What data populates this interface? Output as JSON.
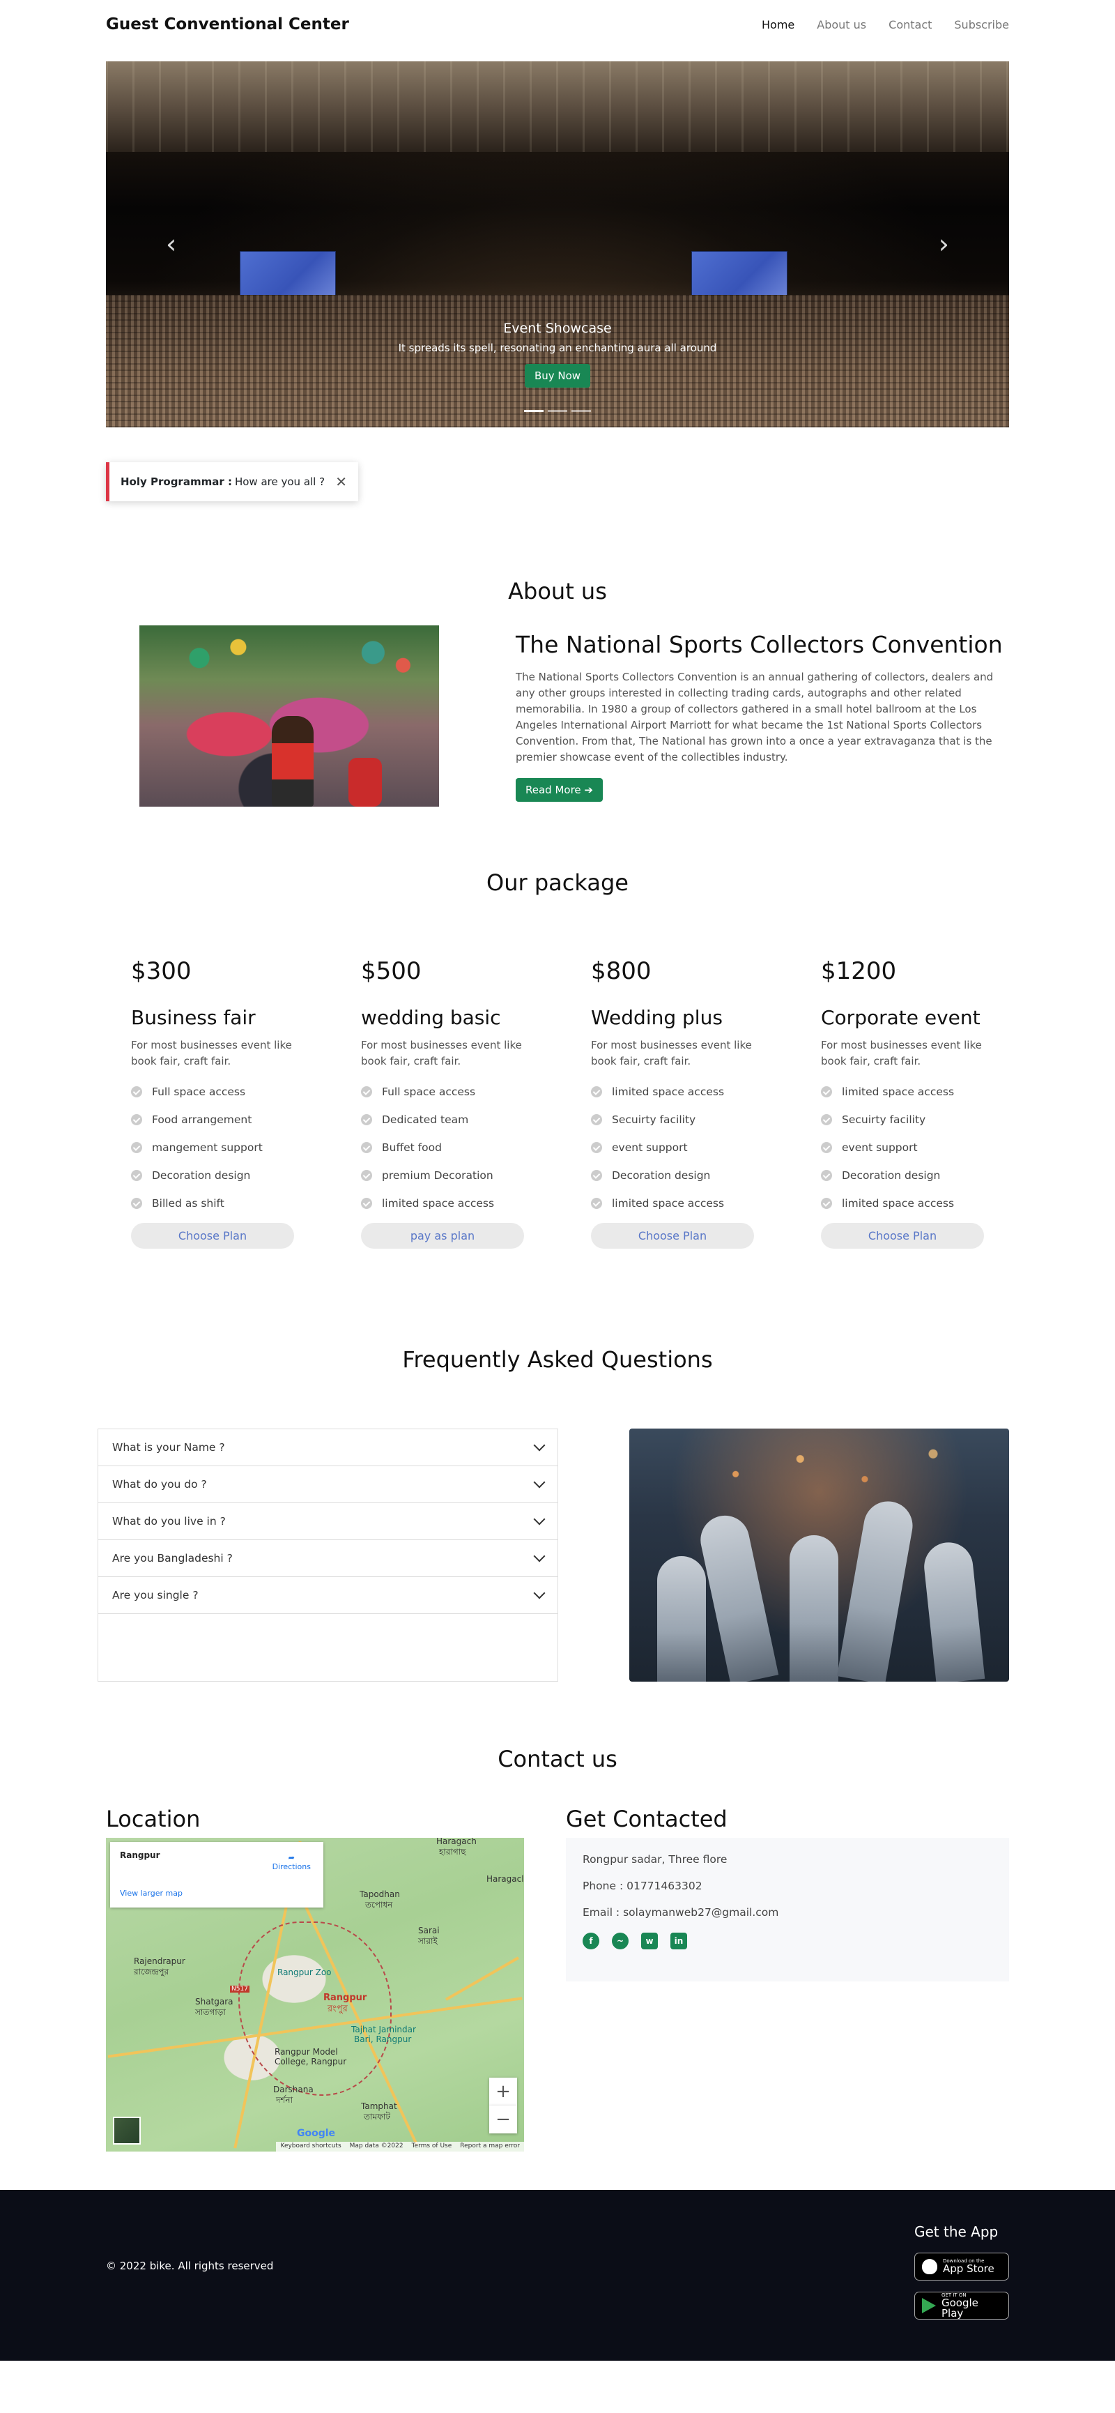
{
  "nav": {
    "brand": "Guest Conventional Center",
    "links": [
      "Home",
      "About us",
      "Contact",
      "Subscribe"
    ]
  },
  "hero": {
    "title": "Event Showcase",
    "subtitle": "It spreads its spell, resonating an enchanting aura all around",
    "button": "Buy Now",
    "prev_icon": "‹",
    "next_icon": "›"
  },
  "toast": {
    "sender": "Holy Programmar :",
    "message": "How are you all ?",
    "close": "✕"
  },
  "about": {
    "section_title": "About us",
    "heading": "The National Sports Collectors Convention",
    "body": "The National Sports Collectors Convention is an annual gathering of collectors, dealers and any other groups interested in collecting trading cards, autographs and other related memorabilia. In 1980 a group of collectors gathered in a small hotel ballroom at the Los Angeles International Airport Marriott for what became the 1st National Sports Collectors Convention. From that, The National has grown into a once a year extravaganza that is the premier showcase event of the collectibles industry.",
    "button": "Read More ➔"
  },
  "packages": {
    "section_title": "Our package",
    "items": [
      {
        "price": "$300",
        "name": "Business fair",
        "desc": "For most businesses event like book fair, craft fair.",
        "features": [
          "Full space access",
          "Food arrangement",
          "mangement support",
          "Decoration design",
          "Billed as shift"
        ],
        "button": "Choose Plan"
      },
      {
        "price": "$500",
        "name": "wedding basic",
        "desc": "For most businesses event like book fair, craft fair.",
        "features": [
          "Full space access",
          "Dedicated team",
          "Buffet food",
          "premium Decoration",
          "limited space access"
        ],
        "button": "pay as plan"
      },
      {
        "price": "$800",
        "name": "Wedding plus",
        "desc": "For most businesses event like book fair, craft fair.",
        "features": [
          "limited space access",
          "Secuirty facility",
          "event support",
          "Decoration design",
          "limited space access"
        ],
        "button": "Choose Plan"
      },
      {
        "price": "$1200",
        "name": "Corporate event",
        "desc": "For most businesses event like book fair, craft fair.",
        "features": [
          "limited space access",
          "Secuirty facility",
          "event support",
          "Decoration design",
          "limited space access"
        ],
        "button": "Choose Plan"
      }
    ]
  },
  "faq": {
    "section_title": "Frequently Asked Questions",
    "questions": [
      "What is your Name ?",
      "What do you do ?",
      "What do you live in ?",
      "Are you Bangladeshi ?",
      "Are you single ?"
    ]
  },
  "contact": {
    "section_title": "Contact us",
    "location_title": "Location",
    "get_title": "Get Contacted",
    "address": "Rongpur sadar, Three flore",
    "phone": "Phone : 01771463302",
    "email": "Email : solaymanweb27@gmail.com",
    "socials": [
      "facebook-icon",
      "messenger-icon",
      "whatsapp-icon",
      "linkedin-icon"
    ],
    "map": {
      "place": "Rangpur",
      "larger_map": "View larger map",
      "directions": "Directions",
      "labels": {
        "haragach": "Haragach",
        "haragach_bn": "হারাগাছ",
        "haragach2": "Haragacl",
        "tapodhan": "Tapodhan",
        "tapodhan_bn": "তপোধন",
        "sarai": "Sarai",
        "sarai_bn": "সারাই",
        "rajendrapur": "Rajendrapur",
        "rajendrapur_bn": "রাজেন্দ্রপুর",
        "rangpur_zoo": "Rangpur Zoo",
        "shatgara": "Shatgara",
        "shatgara_bn": "সাতগাড়া",
        "rangpur": "Rangpur",
        "rangpur_bn": "রংপুর",
        "tajhat": "Tajhat Jamindar",
        "tajhat2": "Bari, Rangpur",
        "model": "Rangpur Model",
        "model2": "College, Rangpur",
        "darshana": "Darshana",
        "darshana_bn": "দর্শনা",
        "tamphat": "Tamphat",
        "tamphat_bn": "তামফাট",
        "n517": "N517",
        "google": "Google"
      },
      "footer_links": [
        "Keyboard shortcuts",
        "Map data ©2022",
        "Terms of Use",
        "Report a map error"
      ],
      "zoom_in": "+",
      "zoom_out": "−"
    }
  },
  "footer": {
    "copyright": "© 2022 bike. All rights reserved",
    "app_title": "Get the App",
    "app_store_small": "Download on the",
    "app_store_big": "App Store",
    "play_small": "GET IT ON",
    "play_big": "Google Play"
  },
  "colors": {
    "accent": "#198754",
    "toast_border": "#dc3545",
    "footer_bg": "#0b0d17",
    "link": "#5a78c8"
  }
}
